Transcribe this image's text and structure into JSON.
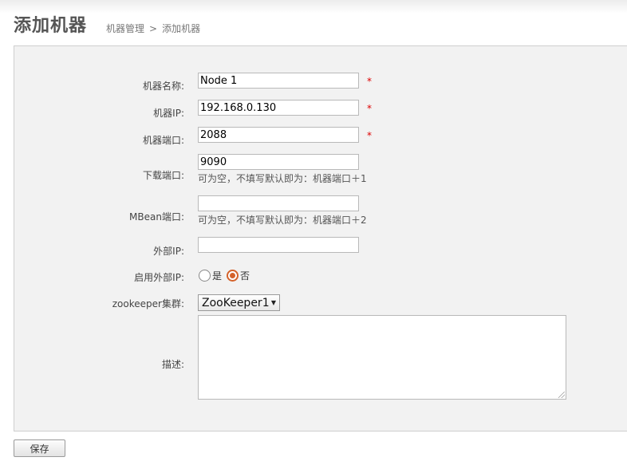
{
  "header": {
    "title": "添加机器",
    "breadcrumb": [
      "机器管理",
      ">",
      "添加机器"
    ]
  },
  "form": {
    "machine_name": {
      "label": "机器名称:",
      "value": "Node 1",
      "required_mark": "*"
    },
    "machine_ip": {
      "label": "机器IP:",
      "value": "192.168.0.130",
      "required_mark": "*"
    },
    "machine_port": {
      "label": "机器端口:",
      "value": "2088",
      "required_mark": "*"
    },
    "download_port": {
      "label": "下载端口:",
      "value": "9090",
      "hint": "可为空，不填写默认即为：机器端口＋1"
    },
    "mbean_port": {
      "label": "MBean端口:",
      "value": "",
      "hint": "可为空，不填写默认即为：机器端口＋2"
    },
    "external_ip": {
      "label": "外部IP:",
      "value": ""
    },
    "enable_external_ip": {
      "label": "启用外部IP:",
      "options": [
        {
          "label": "是",
          "checked": false
        },
        {
          "label": "否",
          "checked": true
        }
      ]
    },
    "zookeeper_cluster": {
      "label": "zookeeper集群:",
      "selected": "ZooKeeper1"
    },
    "description": {
      "label": "描述:",
      "value": ""
    }
  },
  "actions": {
    "save_label": "保存"
  },
  "colors": {
    "required": "#dd0000",
    "radio_checked": "#d4622b",
    "panel_bg": "#f2f2f2"
  }
}
